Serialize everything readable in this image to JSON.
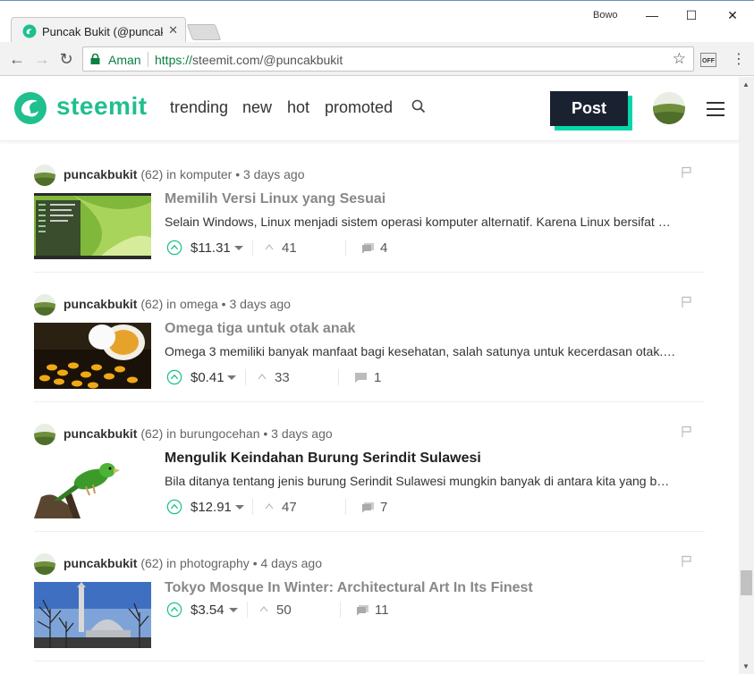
{
  "browser": {
    "tab_title": "Puncak Bukit (@puncakb",
    "profile_name": "Bowo",
    "secure_label": "Aman",
    "url_scheme": "https://",
    "url_rest": "steemit.com/@puncakbukit",
    "extension_label": "OFF"
  },
  "site": {
    "logo_text": "steemit",
    "nav": [
      "trending",
      "new",
      "hot",
      "promoted"
    ],
    "post_button": "Post",
    "accent_color": "#06d6a9",
    "brand_color": "#1fbf8f"
  },
  "posts": [
    {
      "author": "puncakbukit",
      "reputation": "(62)",
      "category_prefix": "in",
      "category": "komputer",
      "time": "• 3 days ago",
      "title": "Memilih Versi Linux yang Sesuai",
      "excerpt": "Selain Windows, Linux menjadi sistem operasi komputer alternatif. Karena Linux bersifat …",
      "payout": "$11.31",
      "votes": "41",
      "comments": "4",
      "title_style": "muted"
    },
    {
      "author": "puncakbukit",
      "reputation": "(62)",
      "category_prefix": "in",
      "category": "omega",
      "time": "• 3 days ago",
      "title": "Omega tiga untuk otak anak",
      "excerpt": "Omega 3 memiliki banyak manfaat bagi kesehatan, salah satunya untuk kecerdasan otak.…",
      "payout": "$0.41",
      "votes": "33",
      "comments": "1",
      "title_style": "muted"
    },
    {
      "author": "puncakbukit",
      "reputation": "(62)",
      "category_prefix": "in",
      "category": "burungocehan",
      "time": "• 3 days ago",
      "title": "Mengulik Keindahan Burung Serindit Sulawesi",
      "excerpt": "Bila ditanya tentang jenis burung Serindit Sulawesi mungkin banyak di antara kita yang b…",
      "payout": "$12.91",
      "votes": "47",
      "comments": "7",
      "title_style": "dark"
    },
    {
      "author": "puncakbukit",
      "reputation": "(62)",
      "category_prefix": "in",
      "category": "photography",
      "time": "• 4 days ago",
      "title": "Tokyo Mosque In Winter: Architectural Art In Its Finest",
      "excerpt": "",
      "payout": "$3.54",
      "votes": "50",
      "comments": "11",
      "title_style": "muted"
    }
  ]
}
